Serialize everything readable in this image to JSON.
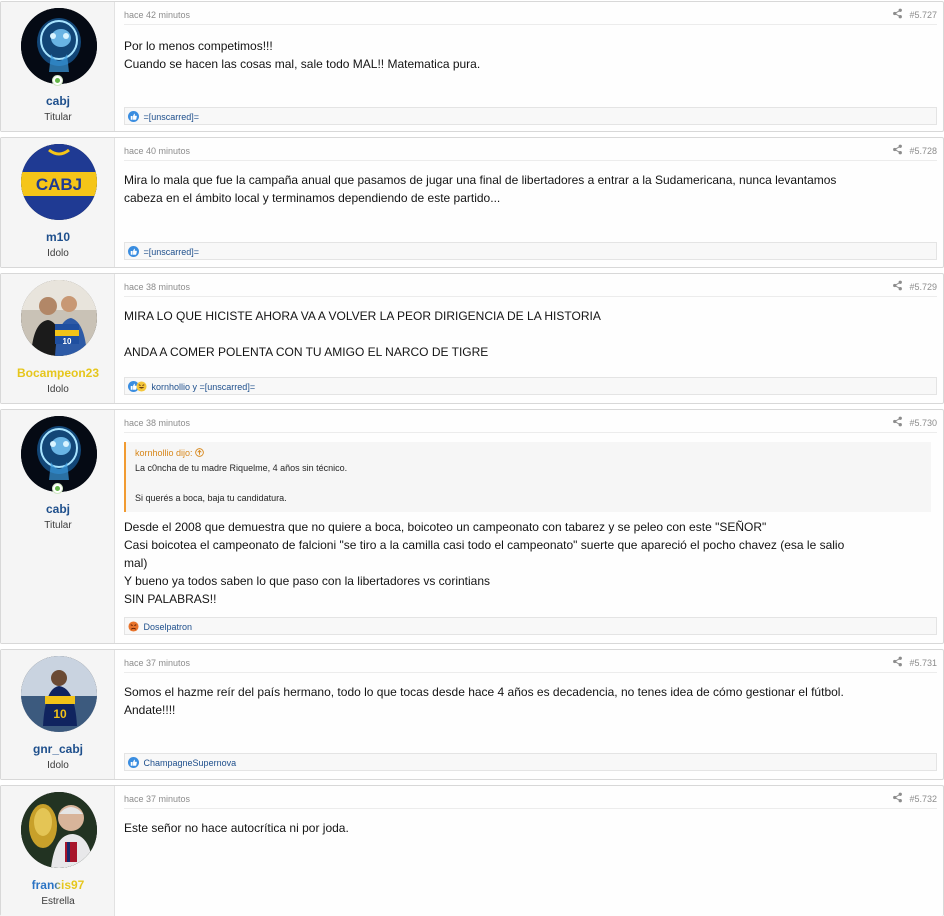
{
  "posts": [
    {
      "user": "cabj",
      "title": "Titular",
      "time": "hace 42 minutos",
      "number": "#5.727",
      "lines": [
        "Por lo menos competimos!!!",
        "Cuando se hacen las cosas mal, sale todo MAL!! Matematica pura."
      ],
      "reactions": "=[unscarred]="
    },
    {
      "user": "m10",
      "title": "Idolo",
      "time": "hace 40 minutos",
      "number": "#5.728",
      "lines": [
        "Mira lo mala que fue la campaña anual que pasamos de jugar una final de libertadores a entrar a la Sudamericana, nunca levantamos",
        "cabeza en el ámbito local y terminamos dependiendo de este partido..."
      ],
      "reactions": "=[unscarred]="
    },
    {
      "user": "Bocampeon23",
      "title": "Idolo",
      "time": "hace 38 minutos",
      "number": "#5.729",
      "lines": [
        "MIRA LO QUE HICISTE AHORA VA A VOLVER LA PEOR DIRIGENCIA DE LA HISTORIA",
        "",
        "ANDA A COMER POLENTA CON TU AMIGO EL NARCO DE TIGRE"
      ],
      "reactions": "kornhollio y =[unscarred]="
    },
    {
      "user": "cabj",
      "title": "Titular",
      "time": "hace 38 minutos",
      "number": "#5.730",
      "quote": {
        "author": "kornhollio dijo:",
        "lines": [
          "La c0ncha de tu madre Riquelme, 4 años sin técnico.",
          "",
          "Si querés a boca, baja tu candidatura."
        ]
      },
      "lines": [
        "Desde el 2008 que demuestra que no quiere a boca, boicoteo un campeonato con tabarez y se peleo con este \"SEÑOR\"",
        "Casi boicotea el campeonato de falcioni \"se tiro a la camilla casi todo el campeonato\" suerte que apareció el pocho chavez (esa le salio",
        "mal)",
        "Y bueno ya todos saben lo que paso con la libertadores vs corintians",
        "SIN PALABRAS!!"
      ],
      "reactions": "Doselpatron"
    },
    {
      "user": "gnr_cabj",
      "title": "Idolo",
      "time": "hace 37 minutos",
      "number": "#5.731",
      "lines": [
        "Somos el hazme reír del país hermano, todo lo que tocas desde hace 4 años es decadencia, no tenes idea de cómo gestionar el fútbol.",
        "Andate!!!!"
      ],
      "reactions": "ChampagneSupernova"
    },
    {
      "user": "francis97",
      "title": "Estrella",
      "time": "hace 37 minutos",
      "number": "#5.732",
      "lines": [
        "Este señor no hace autocrítica ni por joda."
      ]
    }
  ],
  "colors": {
    "username": "#1e4f8c",
    "username_gold": "#e6c61c",
    "accent_orange": "#f19b32",
    "online_green": "#63b648"
  },
  "icons": {
    "share": "share-icon",
    "like": "thumbs-up-icon",
    "laugh": "laugh-icon",
    "angry": "angry-face-icon",
    "quote_jump": "arrow-up-circle-icon"
  }
}
